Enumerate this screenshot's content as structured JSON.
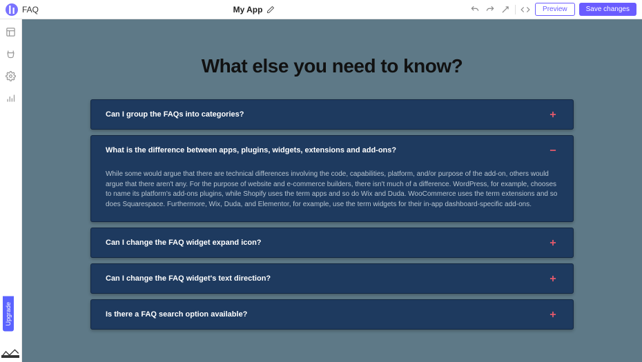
{
  "topbar": {
    "page_label": "FAQ",
    "app_name": "My App",
    "preview_label": "Preview",
    "save_label": "Save changes"
  },
  "sidebar": {
    "upgrade_label": "Upgrade"
  },
  "main": {
    "title": "What else you need to know?",
    "faq": [
      {
        "question": "Can I group the FAQs into categories?",
        "expanded": false,
        "answer": ""
      },
      {
        "question": "What is the difference between apps, plugins, widgets, extensions and add-ons?",
        "expanded": true,
        "answer": "While some would argue that there are technical differences involving the code, capabilities, platform, and/or purpose of the add-on, others would argue that there aren't any. For the purpose of website and e-commerce builders, there isn't much of a difference. WordPress, for example, chooses to name its platform's add-ons plugins, while Shopify uses the term apps and so do Wix and Duda. WooCommerce uses the term extensions and so does Squarespace. Furthermore, Wix, Duda, and Elementor, for example, use the term widgets for their in-app dashboard-specific add-ons."
      },
      {
        "question": "Can I change the FAQ widget expand icon?",
        "expanded": false,
        "answer": ""
      },
      {
        "question": "Can I change the FAQ widget's text direction?",
        "expanded": false,
        "answer": ""
      },
      {
        "question": "Is there a FAQ search option available?",
        "expanded": false,
        "answer": ""
      }
    ]
  },
  "colors": {
    "canvas_bg": "#5e7987",
    "panel_bg": "#1e3a5f",
    "accent": "#e85a6b",
    "primary": "#6a5cff"
  }
}
